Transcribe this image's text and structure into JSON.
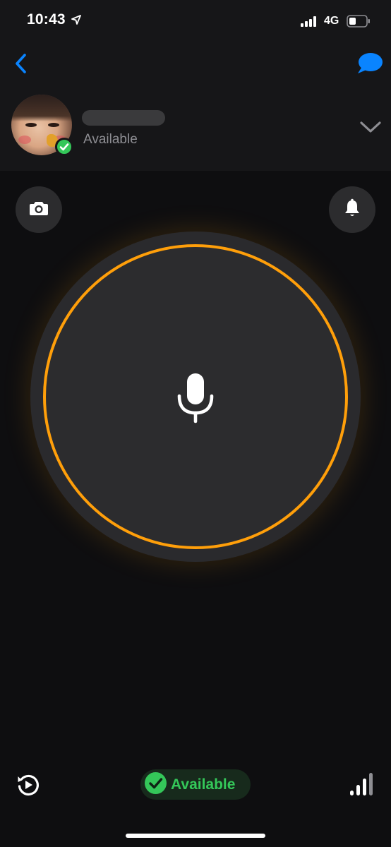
{
  "status_bar": {
    "time": "10:43",
    "network_type": "4G",
    "icons": [
      "location-arrow-icon",
      "cellular-signal-icon",
      "battery-icon"
    ]
  },
  "header": {
    "back_icon": "chevron-left-icon",
    "chat_icon": "chat-bubble-icon",
    "contact_status": "Available",
    "expand_icon": "chevron-down-icon"
  },
  "actions": {
    "camera_icon": "camera-icon",
    "alert_icon": "bell-icon"
  },
  "talk_button": {
    "icon": "microphone-icon"
  },
  "footer": {
    "replay_icon": "replay-icon",
    "availability_label": "Available",
    "signal_icon": "signal-bars-icon"
  },
  "colors": {
    "accent_blue": "#0a84ff",
    "ring_orange": "#ff9f0a",
    "available_green": "#34c759",
    "background": "#0e0e10",
    "header_background": "#161618",
    "button_gray": "#2c2c2e"
  }
}
